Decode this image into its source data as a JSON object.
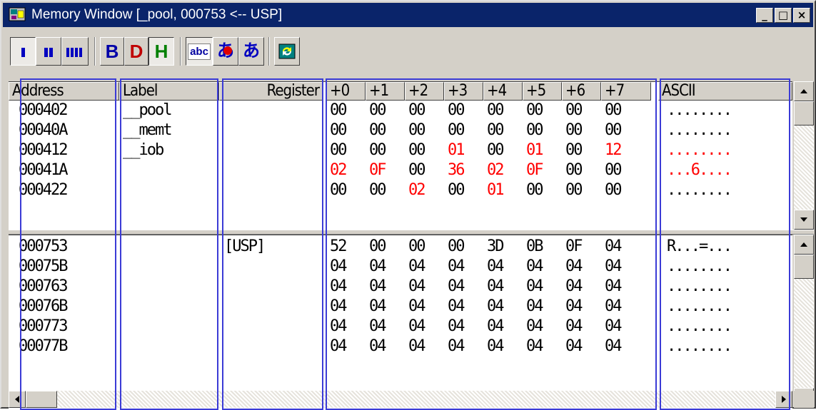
{
  "window": {
    "title": "Memory Window [_pool, 000753 <-- USP]",
    "accent": "#0a246a",
    "buttons": {
      "minimize": "_",
      "maximize": "□",
      "close": "×"
    }
  },
  "toolbar": {
    "size_buttons": [
      {
        "id": "byte",
        "icon": "single-bar-icon",
        "pressed": true
      },
      {
        "id": "word",
        "icon": "double-bar-icon",
        "pressed": false
      },
      {
        "id": "long",
        "icon": "quad-bar-icon",
        "pressed": false
      }
    ],
    "radix_buttons": [
      {
        "id": "bin",
        "label": "B",
        "color": "#0000a8"
      },
      {
        "id": "dec",
        "label": "D",
        "color": "#c00000"
      },
      {
        "id": "hex",
        "label": "H",
        "color": "#008000",
        "pressed": true
      }
    ],
    "text_buttons": [
      {
        "id": "ascii",
        "label": "abc",
        "pressed": true
      },
      {
        "id": "sjis",
        "label": "あ",
        "color": "#0000c0"
      },
      {
        "id": "euc",
        "label": "あ",
        "color": "#0000c0"
      }
    ],
    "refresh_icon": "refresh-icon"
  },
  "columns": {
    "address": "Address",
    "label": "Label",
    "register": "Register",
    "offsets": [
      "+0",
      "+1",
      "+2",
      "+3",
      "+4",
      "+5",
      "+6",
      "+7"
    ],
    "ascii": "ASCII"
  },
  "pane1": {
    "rows": [
      {
        "address": "000402",
        "label": "__pool",
        "register": "",
        "bytes": [
          "00",
          "00",
          "00",
          "00",
          "00",
          "00",
          "00",
          "00"
        ],
        "changed": [
          false,
          false,
          false,
          false,
          false,
          false,
          false,
          false
        ],
        "ascii": "........",
        "ascii_changed": false
      },
      {
        "address": "00040A",
        "label": "__memt",
        "register": "",
        "bytes": [
          "00",
          "00",
          "00",
          "00",
          "00",
          "00",
          "00",
          "00"
        ],
        "changed": [
          false,
          false,
          false,
          false,
          false,
          false,
          false,
          false
        ],
        "ascii": "........",
        "ascii_changed": false
      },
      {
        "address": "000412",
        "label": "__iob",
        "register": "",
        "bytes": [
          "00",
          "00",
          "00",
          "01",
          "00",
          "01",
          "00",
          "12"
        ],
        "changed": [
          false,
          false,
          false,
          true,
          false,
          true,
          false,
          true
        ],
        "ascii": "........",
        "ascii_changed": true
      },
      {
        "address": "00041A",
        "label": "",
        "register": "",
        "bytes": [
          "02",
          "0F",
          "00",
          "36",
          "02",
          "0F",
          "00",
          "00"
        ],
        "changed": [
          true,
          true,
          false,
          true,
          true,
          true,
          false,
          false
        ],
        "ascii": "...6....",
        "ascii_changed": true
      },
      {
        "address": "000422",
        "label": "",
        "register": "",
        "bytes": [
          "00",
          "00",
          "02",
          "00",
          "01",
          "00",
          "00",
          "00"
        ],
        "changed": [
          false,
          false,
          true,
          false,
          true,
          false,
          false,
          false
        ],
        "ascii": "........",
        "ascii_changed": false
      }
    ]
  },
  "pane2": {
    "rows": [
      {
        "address": "000753",
        "label": "",
        "register": "[USP]",
        "bytes": [
          "52",
          "00",
          "00",
          "00",
          "3D",
          "0B",
          "0F",
          "04"
        ],
        "changed": [
          false,
          false,
          false,
          false,
          false,
          false,
          false,
          false
        ],
        "ascii": "R...=...",
        "ascii_changed": false
      },
      {
        "address": "00075B",
        "label": "",
        "register": "",
        "bytes": [
          "04",
          "04",
          "04",
          "04",
          "04",
          "04",
          "04",
          "04"
        ],
        "changed": [
          false,
          false,
          false,
          false,
          false,
          false,
          false,
          false
        ],
        "ascii": "........",
        "ascii_changed": false
      },
      {
        "address": "000763",
        "label": "",
        "register": "",
        "bytes": [
          "04",
          "04",
          "04",
          "04",
          "04",
          "04",
          "04",
          "04"
        ],
        "changed": [
          false,
          false,
          false,
          false,
          false,
          false,
          false,
          false
        ],
        "ascii": "........",
        "ascii_changed": false
      },
      {
        "address": "00076B",
        "label": "",
        "register": "",
        "bytes": [
          "04",
          "04",
          "04",
          "04",
          "04",
          "04",
          "04",
          "04"
        ],
        "changed": [
          false,
          false,
          false,
          false,
          false,
          false,
          false,
          false
        ],
        "ascii": "........",
        "ascii_changed": false
      },
      {
        "address": "000773",
        "label": "",
        "register": "",
        "bytes": [
          "04",
          "04",
          "04",
          "04",
          "04",
          "04",
          "04",
          "04"
        ],
        "changed": [
          false,
          false,
          false,
          false,
          false,
          false,
          false,
          false
        ],
        "ascii": "........",
        "ascii_changed": false
      },
      {
        "address": "00077B",
        "label": "",
        "register": "",
        "bytes": [
          "04",
          "04",
          "04",
          "04",
          "04",
          "04",
          "04",
          "04"
        ],
        "changed": [
          false,
          false,
          false,
          false,
          false,
          false,
          false,
          false
        ],
        "ascii": "........",
        "ascii_changed": false
      }
    ]
  },
  "colors": {
    "changed": "#ff0000",
    "highlight_box": "#3b3bd6"
  }
}
